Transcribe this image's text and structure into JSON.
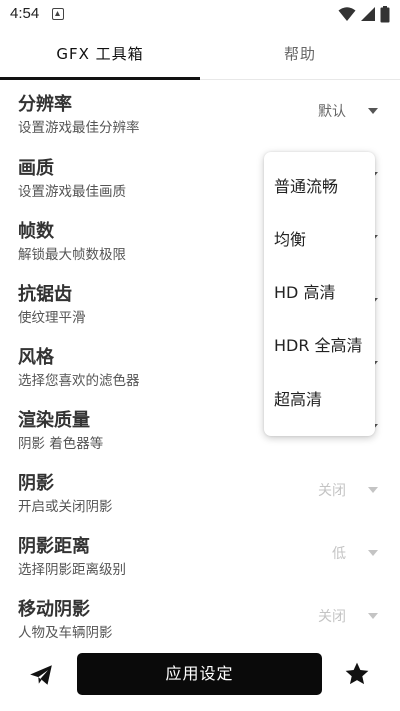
{
  "status_bar": {
    "time": "4:54"
  },
  "tabs": [
    {
      "label": "GFX 工具箱",
      "active": true
    },
    {
      "label": "帮助",
      "active": false
    }
  ],
  "settings": [
    {
      "title": "分辨率",
      "subtitle": "设置游戏最佳分辨率",
      "value": "默认",
      "enabled": true
    },
    {
      "title": "画质",
      "subtitle": "设置游戏最佳画质",
      "value": "",
      "enabled": true
    },
    {
      "title": "帧数",
      "subtitle": "解锁最大帧数极限",
      "value": "",
      "enabled": true
    },
    {
      "title": "抗锯齿",
      "subtitle": "使纹理平滑",
      "value": "",
      "enabled": true
    },
    {
      "title": "风格",
      "subtitle": "选择您喜欢的滤色器",
      "value": "",
      "enabled": true
    },
    {
      "title": "渲染质量",
      "subtitle": "阴影 着色器等",
      "value": "",
      "enabled": true
    },
    {
      "title": "阴影",
      "subtitle": "开启或关闭阴影",
      "value": "关闭",
      "enabled": false
    },
    {
      "title": "阴影距离",
      "subtitle": "选择阴影距离级别",
      "value": "低",
      "enabled": false
    },
    {
      "title": "移动阴影",
      "subtitle": "人物及车辆阴影",
      "value": "关闭",
      "enabled": false
    }
  ],
  "dropdown": {
    "options": [
      "普通流畅",
      "均衡",
      "HD 高清",
      "HDR 全高清",
      "超高清"
    ]
  },
  "bottom_bar": {
    "apply_label": "应用设定",
    "send_icon": "send-icon",
    "star_icon": "star-icon"
  },
  "colors": {
    "primary": "#0a0a0a",
    "disabled": "#c4c4c4"
  }
}
